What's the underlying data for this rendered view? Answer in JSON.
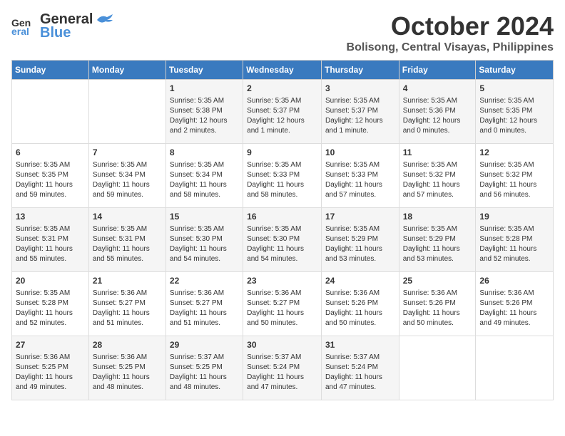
{
  "logo": {
    "line1": "General",
    "line2": "Blue"
  },
  "title": "October 2024",
  "location": "Bolisong, Central Visayas, Philippines",
  "weekdays": [
    "Sunday",
    "Monday",
    "Tuesday",
    "Wednesday",
    "Thursday",
    "Friday",
    "Saturday"
  ],
  "weeks": [
    [
      {
        "day": "",
        "info": ""
      },
      {
        "day": "",
        "info": ""
      },
      {
        "day": "1",
        "info": "Sunrise: 5:35 AM\nSunset: 5:38 PM\nDaylight: 12 hours\nand 2 minutes."
      },
      {
        "day": "2",
        "info": "Sunrise: 5:35 AM\nSunset: 5:37 PM\nDaylight: 12 hours\nand 1 minute."
      },
      {
        "day": "3",
        "info": "Sunrise: 5:35 AM\nSunset: 5:37 PM\nDaylight: 12 hours\nand 1 minute."
      },
      {
        "day": "4",
        "info": "Sunrise: 5:35 AM\nSunset: 5:36 PM\nDaylight: 12 hours\nand 0 minutes."
      },
      {
        "day": "5",
        "info": "Sunrise: 5:35 AM\nSunset: 5:35 PM\nDaylight: 12 hours\nand 0 minutes."
      }
    ],
    [
      {
        "day": "6",
        "info": "Sunrise: 5:35 AM\nSunset: 5:35 PM\nDaylight: 11 hours\nand 59 minutes."
      },
      {
        "day": "7",
        "info": "Sunrise: 5:35 AM\nSunset: 5:34 PM\nDaylight: 11 hours\nand 59 minutes."
      },
      {
        "day": "8",
        "info": "Sunrise: 5:35 AM\nSunset: 5:34 PM\nDaylight: 11 hours\nand 58 minutes."
      },
      {
        "day": "9",
        "info": "Sunrise: 5:35 AM\nSunset: 5:33 PM\nDaylight: 11 hours\nand 58 minutes."
      },
      {
        "day": "10",
        "info": "Sunrise: 5:35 AM\nSunset: 5:33 PM\nDaylight: 11 hours\nand 57 minutes."
      },
      {
        "day": "11",
        "info": "Sunrise: 5:35 AM\nSunset: 5:32 PM\nDaylight: 11 hours\nand 57 minutes."
      },
      {
        "day": "12",
        "info": "Sunrise: 5:35 AM\nSunset: 5:32 PM\nDaylight: 11 hours\nand 56 minutes."
      }
    ],
    [
      {
        "day": "13",
        "info": "Sunrise: 5:35 AM\nSunset: 5:31 PM\nDaylight: 11 hours\nand 55 minutes."
      },
      {
        "day": "14",
        "info": "Sunrise: 5:35 AM\nSunset: 5:31 PM\nDaylight: 11 hours\nand 55 minutes."
      },
      {
        "day": "15",
        "info": "Sunrise: 5:35 AM\nSunset: 5:30 PM\nDaylight: 11 hours\nand 54 minutes."
      },
      {
        "day": "16",
        "info": "Sunrise: 5:35 AM\nSunset: 5:30 PM\nDaylight: 11 hours\nand 54 minutes."
      },
      {
        "day": "17",
        "info": "Sunrise: 5:35 AM\nSunset: 5:29 PM\nDaylight: 11 hours\nand 53 minutes."
      },
      {
        "day": "18",
        "info": "Sunrise: 5:35 AM\nSunset: 5:29 PM\nDaylight: 11 hours\nand 53 minutes."
      },
      {
        "day": "19",
        "info": "Sunrise: 5:35 AM\nSunset: 5:28 PM\nDaylight: 11 hours\nand 52 minutes."
      }
    ],
    [
      {
        "day": "20",
        "info": "Sunrise: 5:35 AM\nSunset: 5:28 PM\nDaylight: 11 hours\nand 52 minutes."
      },
      {
        "day": "21",
        "info": "Sunrise: 5:36 AM\nSunset: 5:27 PM\nDaylight: 11 hours\nand 51 minutes."
      },
      {
        "day": "22",
        "info": "Sunrise: 5:36 AM\nSunset: 5:27 PM\nDaylight: 11 hours\nand 51 minutes."
      },
      {
        "day": "23",
        "info": "Sunrise: 5:36 AM\nSunset: 5:27 PM\nDaylight: 11 hours\nand 50 minutes."
      },
      {
        "day": "24",
        "info": "Sunrise: 5:36 AM\nSunset: 5:26 PM\nDaylight: 11 hours\nand 50 minutes."
      },
      {
        "day": "25",
        "info": "Sunrise: 5:36 AM\nSunset: 5:26 PM\nDaylight: 11 hours\nand 50 minutes."
      },
      {
        "day": "26",
        "info": "Sunrise: 5:36 AM\nSunset: 5:26 PM\nDaylight: 11 hours\nand 49 minutes."
      }
    ],
    [
      {
        "day": "27",
        "info": "Sunrise: 5:36 AM\nSunset: 5:25 PM\nDaylight: 11 hours\nand 49 minutes."
      },
      {
        "day": "28",
        "info": "Sunrise: 5:36 AM\nSunset: 5:25 PM\nDaylight: 11 hours\nand 48 minutes."
      },
      {
        "day": "29",
        "info": "Sunrise: 5:37 AM\nSunset: 5:25 PM\nDaylight: 11 hours\nand 48 minutes."
      },
      {
        "day": "30",
        "info": "Sunrise: 5:37 AM\nSunset: 5:24 PM\nDaylight: 11 hours\nand 47 minutes."
      },
      {
        "day": "31",
        "info": "Sunrise: 5:37 AM\nSunset: 5:24 PM\nDaylight: 11 hours\nand 47 minutes."
      },
      {
        "day": "",
        "info": ""
      },
      {
        "day": "",
        "info": ""
      }
    ]
  ]
}
